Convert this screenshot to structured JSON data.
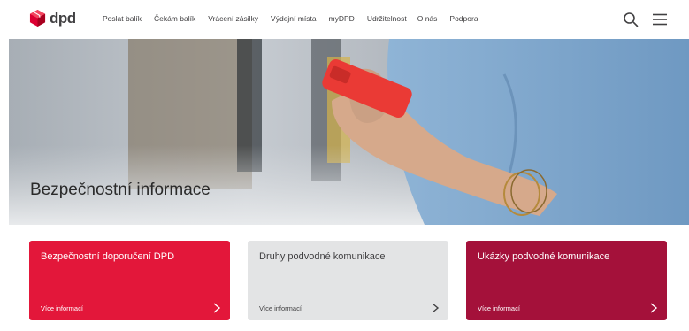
{
  "brand": {
    "name": "dpd",
    "color": "#dc0032"
  },
  "nav": {
    "items": [
      "Poslat balík",
      "Čekám balík",
      "Vrácení zásilky",
      "Výdejní místa",
      "myDPD",
      "Udržitelnost",
      "O nás",
      "Podpora"
    ],
    "icons": [
      "search-icon",
      "menu-icon"
    ]
  },
  "hero": {
    "title": "Bezpečnostní informace"
  },
  "cards": [
    {
      "title": "Bezpečnostní doporučení DPD",
      "link": "Více informací",
      "bg": "#e3173a",
      "fg": "#ffffff"
    },
    {
      "title": "Druhy podvodné komunikace",
      "link": "Více informací",
      "bg": "#e3e4e5",
      "fg": "#414042"
    },
    {
      "title": "Ukázky podvodné komunikace",
      "link": "Více informací",
      "bg": "#a4113a",
      "fg": "#ffffff"
    }
  ]
}
